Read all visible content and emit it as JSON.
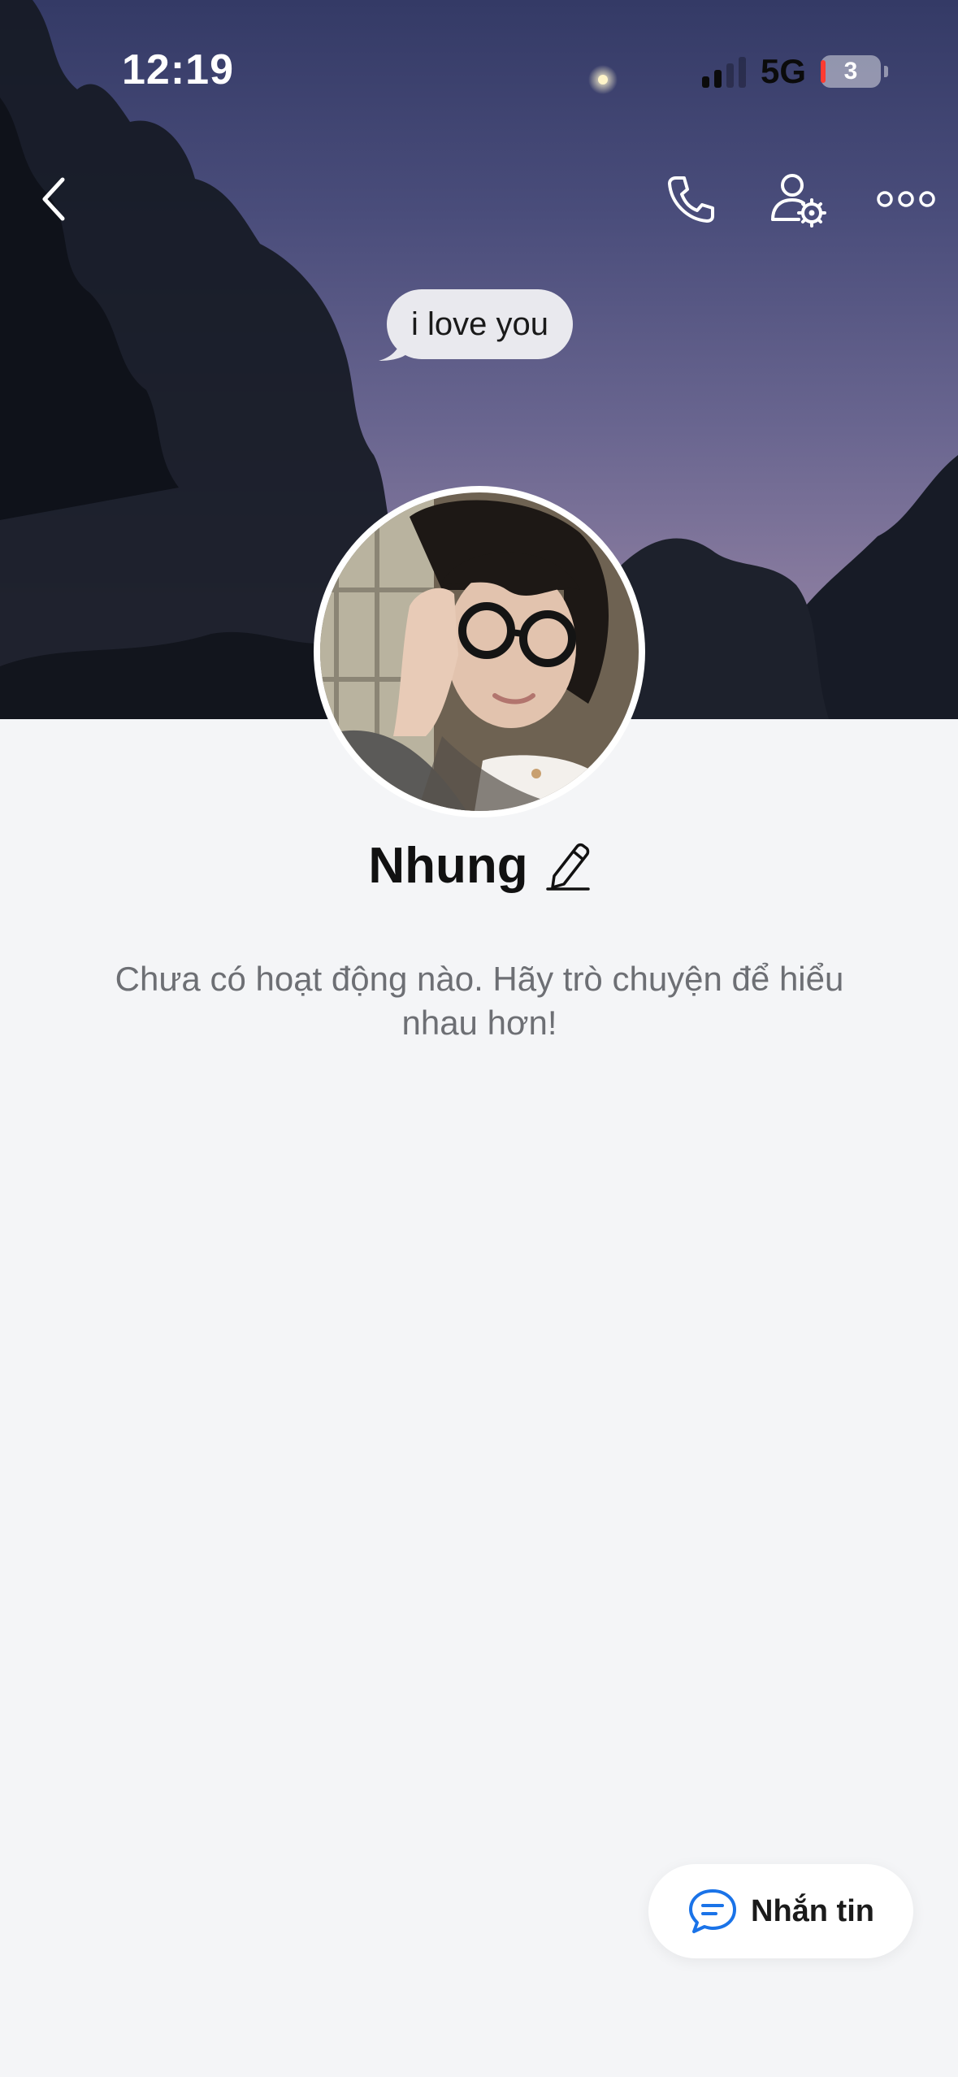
{
  "status_bar": {
    "time": "12:19",
    "network": "5G",
    "battery": "3"
  },
  "cover": {
    "bubble_text": "i love you"
  },
  "header_icons": [
    "back-icon",
    "phone-icon",
    "user-settings-icon",
    "more-icon"
  ],
  "profile": {
    "name": "Nhung",
    "empty_hint": "Chưa có hoạt động nào. Hãy trò chuyện để hiểu nhau hơn!"
  },
  "actions": {
    "message_label": "Nhắn tin"
  },
  "colors": {
    "accent": "#1a73e8",
    "background": "#f4f5f7",
    "hint_text": "#6d6f74"
  }
}
